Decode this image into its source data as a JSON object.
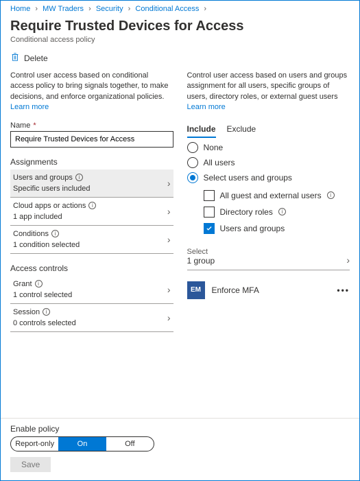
{
  "breadcrumb": {
    "items": [
      "Home",
      "MW Traders",
      "Security",
      "Conditional Access"
    ],
    "sep": "›"
  },
  "header": {
    "title": "Require Trusted Devices for Access",
    "subtitle": "Conditional access policy",
    "delete_label": "Delete"
  },
  "left": {
    "description": "Control user access based on conditional access policy to bring signals together, to make decisions, and enforce organizational policies.",
    "learn_more": "Learn more",
    "name_label": "Name",
    "name_value": "Require Trusted Devices for Access",
    "assignments_header": "Assignments",
    "rows": [
      {
        "label": "Users and groups",
        "sub": "Specific users included",
        "selected": true
      },
      {
        "label": "Cloud apps or actions",
        "sub": "1 app included",
        "selected": false
      },
      {
        "label": "Conditions",
        "sub": "1 condition selected",
        "selected": false
      }
    ],
    "access_header": "Access controls",
    "controls": [
      {
        "label": "Grant",
        "sub": "1 control selected"
      },
      {
        "label": "Session",
        "sub": "0 controls selected"
      }
    ]
  },
  "right": {
    "description": "Control user access based on users and groups assignment for all users, specific groups of users, directory roles, or external guest users",
    "learn_more": "Learn more",
    "tabs": {
      "include": "Include",
      "exclude": "Exclude",
      "active": "include"
    },
    "radios": [
      {
        "label": "None",
        "selected": false
      },
      {
        "label": "All users",
        "selected": false
      },
      {
        "label": "Select users and groups",
        "selected": true
      }
    ],
    "checkboxes": [
      {
        "label": "All guest and external users",
        "checked": false,
        "info": true
      },
      {
        "label": "Directory roles",
        "checked": false,
        "info": true
      },
      {
        "label": "Users and groups",
        "checked": true,
        "info": false
      }
    ],
    "select": {
      "label": "Select",
      "value": "1 group"
    },
    "group": {
      "initials": "EM",
      "name": "Enforce MFA"
    }
  },
  "footer": {
    "label": "Enable policy",
    "options": {
      "report": "Report-only",
      "on": "On",
      "off": "Off",
      "active": "on"
    },
    "save": "Save"
  }
}
